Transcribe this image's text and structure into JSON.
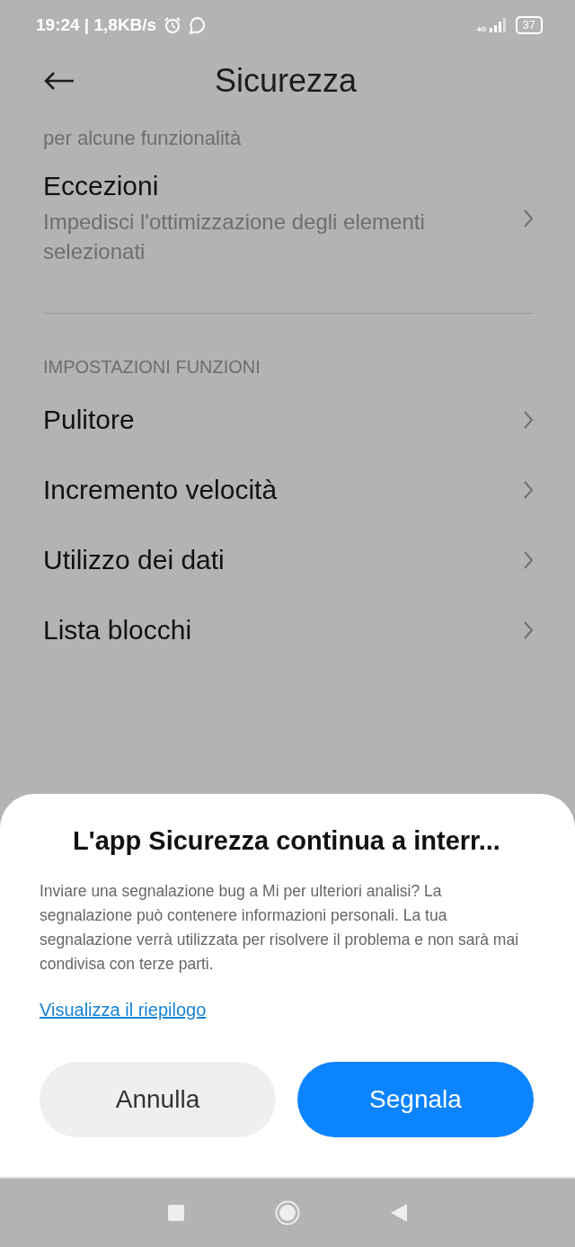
{
  "status_bar": {
    "time": "19:24 | 1,8KB/s",
    "network": "4G",
    "battery": "37"
  },
  "header": {
    "title": "Sicurezza"
  },
  "settings": {
    "partial_text": "per alcune funzionalità",
    "items": [
      {
        "kind": "item",
        "title": "Eccezioni",
        "subtitle": "Impedisci l'ottimizzazione degli elementi selezionati"
      },
      {
        "kind": "divider"
      },
      {
        "kind": "section",
        "title": "IMPOSTAZIONI FUNZIONI"
      },
      {
        "kind": "item",
        "title": "Pulitore"
      },
      {
        "kind": "item",
        "title": "Incremento velocità"
      },
      {
        "kind": "item",
        "title": "Utilizzo dei dati"
      },
      {
        "kind": "item",
        "title": "Lista blocchi"
      }
    ]
  },
  "dialog": {
    "title": "L'app Sicurezza continua a interr...",
    "message": "Inviare una segnalazione bug a Mi per ulteriori analisi? La segnalazione può contenere informazioni personali. La tua segnalazione verrà utilizzata per risolvere il problema e non sarà mai condivisa con terze parti.",
    "link": "Visualizza il riepilogo",
    "buttons": [
      {
        "kind": "secondary",
        "label": "Annulla"
      },
      {
        "kind": "primary",
        "label": "Segnala"
      }
    ]
  }
}
